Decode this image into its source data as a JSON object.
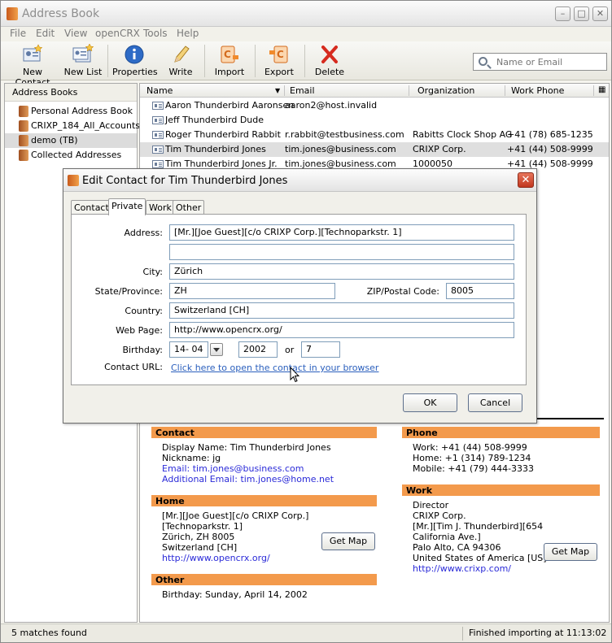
{
  "window": {
    "title": "Address Book"
  },
  "menu": [
    "File",
    "Edit",
    "View",
    "openCRX",
    "Tools",
    "Help"
  ],
  "toolbar": {
    "new_contact": "New Contact",
    "new_list": "New List",
    "properties": "Properties",
    "write": "Write",
    "import": "Import",
    "export": "Export",
    "delete": "Delete"
  },
  "search": {
    "placeholder": "Name or Email"
  },
  "sidebar": {
    "header": "Address Books",
    "books": [
      "Personal Address Book",
      "CRIXP_184_All_Accounts",
      "demo (TB)",
      "Collected Addresses"
    ]
  },
  "columns": {
    "name": "Name",
    "email": "Email",
    "organization": "Organization",
    "work_phone": "Work Phone"
  },
  "contacts": [
    {
      "name": "Aaron Thunderbird Aaronsen",
      "email": "aaron2@host.invalid",
      "org": "",
      "phone": ""
    },
    {
      "name": "Jeff Thunderbird Dude",
      "email": "",
      "org": "",
      "phone": ""
    },
    {
      "name": "Roger Thunderbird Rabbit",
      "email": "r.rabbit@testbusiness.com",
      "org": "Rabitts Clock Shop AG",
      "phone": "+41 (78) 685-1235"
    },
    {
      "name": "Tim Thunderbird Jones",
      "email": "tim.jones@business.com",
      "org": "CRIXP Corp.",
      "phone": "+41 (44) 508-9999"
    },
    {
      "name": "Tim Thunderbird Jones Jr.",
      "email": "tim.jones@business.com",
      "org": "1000050",
      "phone": "+41 (44) 508-9999"
    }
  ],
  "card": {
    "contact_header": "Contact",
    "display_name": "Display Name: Tim Thunderbird Jones",
    "nickname": "Nickname: jg",
    "email": "Email: tim.jones@business.com",
    "additional_email": "Additional Email: tim.jones@home.net",
    "home_header": "Home",
    "home_lines": [
      "[Mr.][Joe Guest][c/o CRIXP Corp.]",
      "[Technoparkstr. 1]",
      "Zürich, ZH 8005",
      "Switzerland [CH]"
    ],
    "home_url": "http://www.opencrx.org/",
    "get_map": "Get Map",
    "other_header": "Other",
    "birthday": "Birthday: Sunday, April 14, 2002",
    "phone_header": "Phone",
    "phone_lines": [
      "Work: +41 (44) 508-9999",
      "Home: +1 (314) 789-1234",
      "Mobile: +41 (79) 444-3333"
    ],
    "work_header": "Work",
    "work_lines": [
      "Director",
      "CRIXP Corp.",
      "[Mr.][Tim J. Thunderbird][654",
      "California Ave.]",
      "Palo Alto, CA 94306",
      "United States of America [US]"
    ],
    "work_url": "http://www.crixp.com/"
  },
  "status": {
    "left": "5 matches found",
    "right": "Finished importing at 11:13:02"
  },
  "dialog": {
    "title": "Edit Contact for Tim Thunderbird Jones",
    "tabs": [
      "Contact",
      "Private",
      "Work",
      "Other"
    ],
    "active_tab": "Private",
    "labels": {
      "address": "Address:",
      "city": "City:",
      "state": "State/Province:",
      "zip": "ZIP/Postal Code:",
      "country": "Country:",
      "web_page": "Web Page:",
      "birthday": "Birthday:",
      "or": "or",
      "contact_url": "Contact URL:"
    },
    "values": {
      "address1": "[Mr.][Joe Guest][c/o CRIXP Corp.][Technoparkstr. 1]",
      "address2": "",
      "city": "Zürich",
      "state": "ZH",
      "zip": "8005",
      "country": "Switzerland [CH]",
      "web_page": "http://www.opencrx.org/",
      "birthday_day_month": "14- 04",
      "birthday_year": "2002",
      "age": "7"
    },
    "contact_url_link": "Click here to open the contact in your browser",
    "ok": "OK",
    "cancel": "Cancel"
  }
}
